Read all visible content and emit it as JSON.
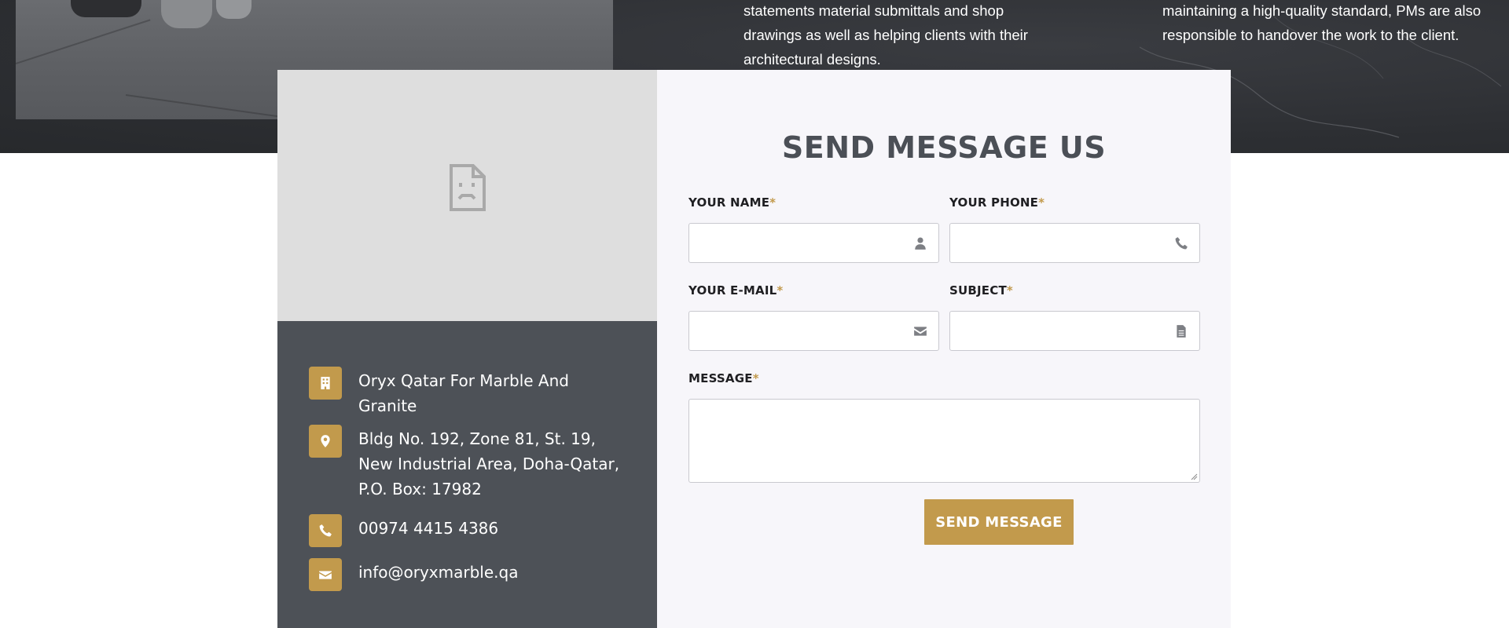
{
  "colors": {
    "accent": "#c29a4c",
    "dark_panel": "#4d5157",
    "form_bg": "#f7f6fa",
    "title": "#4b4f56"
  },
  "top_section": {
    "column_a": "statements material submittals and shop drawings as well as helping clients with their architectural designs.",
    "column_b": "maintaining a high-quality standard, PMs are also responsible to handover the work to the client."
  },
  "map": {
    "icon": "broken-document-icon"
  },
  "contact": {
    "company": {
      "icon": "building-icon",
      "text": "Oryx Qatar For Marble And Granite"
    },
    "address": {
      "icon": "map-marker-icon",
      "text": "Bldg No. 192, Zone 81, St. 19, New Industrial Area, Doha-Qatar, P.O. Box: 17982"
    },
    "phone": {
      "icon": "phone-icon",
      "text": "00974 4415 4386"
    },
    "email": {
      "icon": "envelope-icon",
      "text": "info@oryxmarble.qa"
    }
  },
  "form": {
    "title": "SEND MESSAGE US",
    "required_mark": "*",
    "name": {
      "label": "YOUR NAME",
      "value": "",
      "icon": "user-icon"
    },
    "phone": {
      "label": "YOUR PHONE",
      "value": "",
      "icon": "phone-icon"
    },
    "email": {
      "label": "YOUR E-MAIL",
      "value": "",
      "icon": "envelope-icon"
    },
    "subject": {
      "label": "SUBJECT",
      "value": "",
      "icon": "file-text-icon"
    },
    "message": {
      "label": "MESSAGE",
      "value": ""
    },
    "submit_label": "SEND MESSAGE"
  }
}
